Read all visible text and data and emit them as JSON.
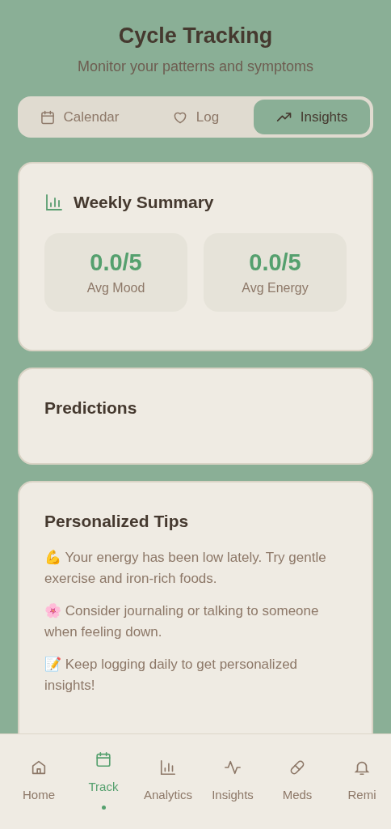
{
  "header": {
    "title": "Cycle Tracking",
    "subtitle": "Monitor your patterns and symptoms"
  },
  "tabs": [
    {
      "label": "Calendar",
      "kind": "calendar",
      "selected": false
    },
    {
      "label": "Log",
      "kind": "heart",
      "selected": false
    },
    {
      "label": "Insights",
      "kind": "trend",
      "selected": true
    }
  ],
  "weekly_summary": {
    "title": "Weekly Summary",
    "stats": [
      {
        "value": "0.0/5",
        "label": "Avg Mood"
      },
      {
        "value": "0.0/5",
        "label": "Avg Energy"
      }
    ]
  },
  "predictions": {
    "title": "Predictions"
  },
  "tips": {
    "title": "Personalized Tips",
    "items": [
      "💪 Your energy has been low lately. Try gentle exercise and iron-rich foods.",
      "🌸 Consider journaling or talking to someone when feeling down.",
      "📝 Keep logging daily to get personalized insights!"
    ]
  },
  "bottom_nav": [
    {
      "label": "Home",
      "kind": "home",
      "selected": false
    },
    {
      "label": "Track",
      "kind": "calendar",
      "selected": true
    },
    {
      "label": "Analytics",
      "kind": "bars",
      "selected": false
    },
    {
      "label": "Insights",
      "kind": "pulse",
      "selected": false
    },
    {
      "label": "Meds",
      "kind": "pill",
      "selected": false
    },
    {
      "label": "Remi",
      "kind": "bell",
      "selected": false
    }
  ]
}
